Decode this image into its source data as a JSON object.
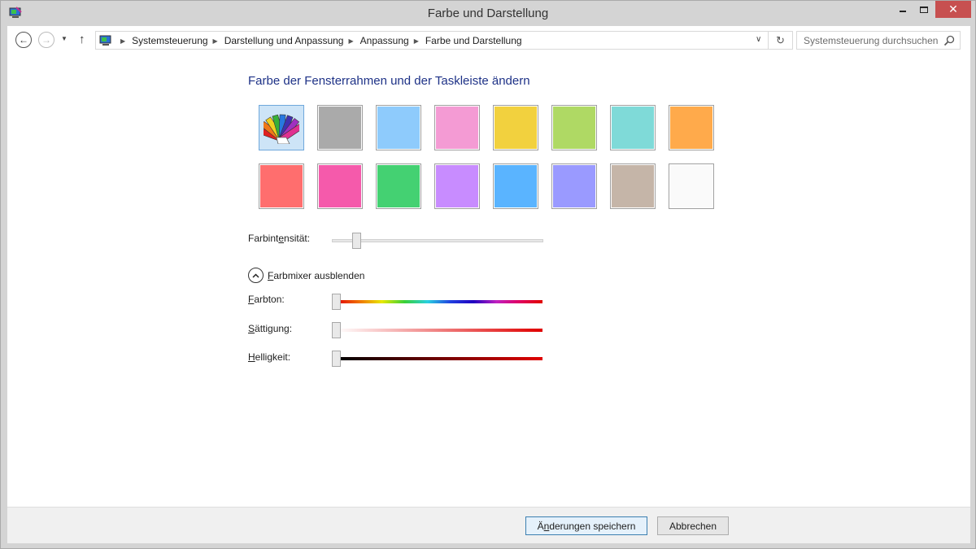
{
  "window": {
    "title": "Farbe und Darstellung"
  },
  "titlebar": {
    "close_glyph": "✕"
  },
  "nav": {
    "back_glyph": "←",
    "forward_glyph": "→",
    "recent_glyph": "▼",
    "up_glyph": "↑",
    "breadcrumbs": [
      "Systemsteuerung",
      "Darstellung und Anpassung",
      "Anpassung",
      "Farbe und Darstellung"
    ],
    "separator": "▶",
    "dropdown_glyph": "∨",
    "refresh_glyph": "↻"
  },
  "search": {
    "placeholder": "Systemsteuerung durchsuchen"
  },
  "main": {
    "heading": "Farbe der Fensterrahmen und der Taskleiste ändern",
    "swatches": [
      {
        "name": "automatic",
        "color": "auto",
        "selected": true
      },
      {
        "name": "gray",
        "color": "#aaaaaa"
      },
      {
        "name": "light-blue",
        "color": "#8ecbfc"
      },
      {
        "name": "pink",
        "color": "#f49bd4"
      },
      {
        "name": "yellow",
        "color": "#f2d13e"
      },
      {
        "name": "green",
        "color": "#afd964"
      },
      {
        "name": "teal",
        "color": "#7fdad8"
      },
      {
        "name": "orange",
        "color": "#ffaa4b"
      },
      {
        "name": "red",
        "color": "#ff6e6e"
      },
      {
        "name": "magenta",
        "color": "#f55aab"
      },
      {
        "name": "emerald",
        "color": "#44d172"
      },
      {
        "name": "lavender",
        "color": "#c88cff"
      },
      {
        "name": "sky-blue",
        "color": "#5ab4ff"
      },
      {
        "name": "periwinkle",
        "color": "#9a9aff"
      },
      {
        "name": "taupe",
        "color": "#c5b5a8"
      },
      {
        "name": "white",
        "color": "#fafafa"
      }
    ],
    "intensity": {
      "label_pre": "Farbint",
      "label_u": "e",
      "label_post": "nsität:",
      "value": 0.1
    },
    "mixer_toggle": {
      "label_u": "F",
      "label_rest": "arbmixer ausblenden"
    },
    "hue": {
      "label_u": "F",
      "label_rest": "arbton:",
      "value": 0
    },
    "saturation": {
      "label_u": "S",
      "label_rest": "ättigung:",
      "value": 0
    },
    "brightness": {
      "label_u": "H",
      "label_rest": "elligkeit:",
      "value": 0
    }
  },
  "footer": {
    "save_pre": "Ä",
    "save_u": "n",
    "save_post": "derungen speichern",
    "cancel": "Abbrechen"
  }
}
